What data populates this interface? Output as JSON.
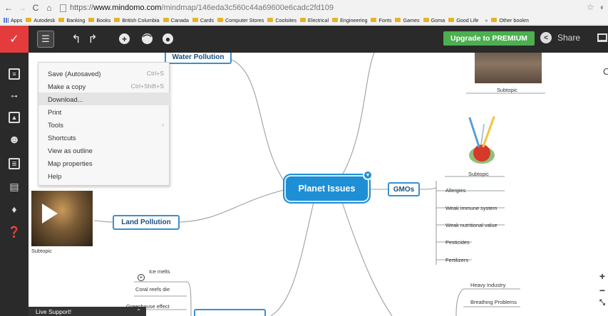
{
  "browser": {
    "url_scheme": "https://",
    "url_host": "www.mindomo.com",
    "url_path": "/mindmap/146eda3c560c44a69600e6cadc2fd109",
    "bookmarks": [
      "Apps",
      "Autodesk",
      "Banking",
      "Books",
      "British Columbia",
      "Canada",
      "Cards",
      "Computer Stores",
      "Coolsites",
      "Electrical",
      "Engineering",
      "Fonts",
      "Games",
      "Goma",
      "Good Life"
    ],
    "more_bookmarks": "»",
    "other_bookmarks": "Other bookm"
  },
  "toolbar": {
    "upgrade_label": "Upgrade to PREMIUM",
    "share_label": "Share"
  },
  "file_menu": {
    "items": [
      {
        "label": "Save (Autosaved)",
        "shortcut": "Ctrl+S"
      },
      {
        "label": "Make a copy",
        "shortcut": "Ctrl+Shift+S"
      },
      {
        "label": "Download...",
        "shortcut": ""
      },
      {
        "label": "Print",
        "shortcut": ""
      },
      {
        "label": "Tools",
        "shortcut": "›"
      },
      {
        "label": "Shortcuts",
        "shortcut": ""
      },
      {
        "label": "View as outline",
        "shortcut": ""
      },
      {
        "label": "Map properties",
        "shortcut": ""
      },
      {
        "label": "Help",
        "shortcut": ""
      }
    ]
  },
  "mindmap": {
    "central": "Planet Issues",
    "water_pollution": "Water Pollution",
    "land_pollution": "Land Pollution",
    "land_subtopic": "Subtopic",
    "gmos": "GMOs",
    "gmos_subtopic": "Subtopic",
    "top_right_subtopic": "Subtopic",
    "gmo_leaves": [
      "Allergies",
      "Weak immune system",
      "Weak nutritional value",
      "Pesticides",
      "Fertilizers"
    ],
    "global_warming_leaves": [
      "Ice melts",
      "Coral reefs die",
      "Greenhouse effect"
    ],
    "industry_leaves": [
      "Heavy Industry",
      "Breathing Problems"
    ],
    "right_edge_letter": "C"
  },
  "live_support": "Live Support!"
}
